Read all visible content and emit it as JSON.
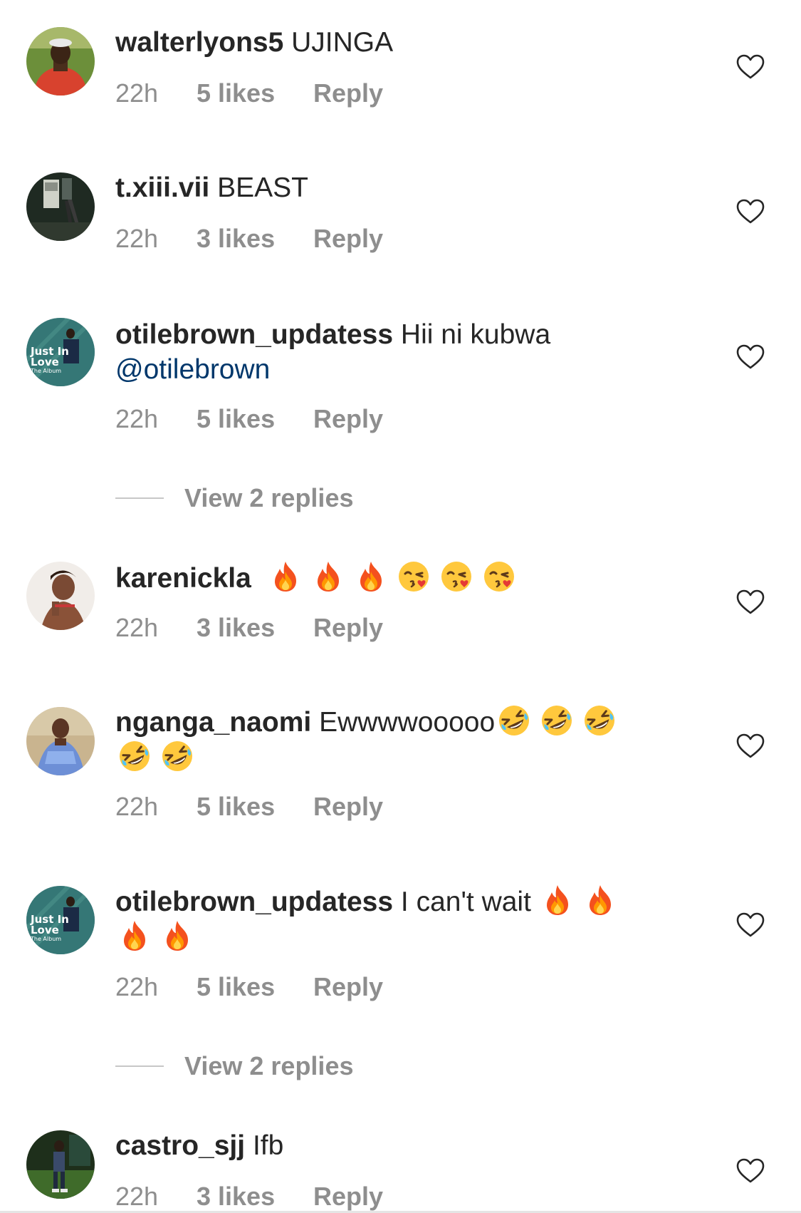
{
  "comments": [
    {
      "username": "walterlyons5",
      "text": "UJINGA",
      "time": "22h",
      "likes": "5 likes",
      "reply": "Reply",
      "avatar": "avatar-photo"
    },
    {
      "username": "t.xiii.vii",
      "text": "BEAST",
      "time": "22h",
      "likes": "3 likes",
      "reply": "Reply",
      "avatar": "avatar-photo"
    },
    {
      "username": "otilebrown_updatess",
      "text": "Hii ni kubwa",
      "mention": "@otilebrown",
      "time": "22h",
      "likes": "5 likes",
      "reply": "Reply",
      "avatar": "avatar-album-cover",
      "view_replies": "View 2 replies"
    },
    {
      "username": "karenickla",
      "text": "",
      "emojis": [
        "fire-emoji",
        "fire-emoji",
        "fire-emoji",
        "kiss-emoji",
        "kiss-emoji",
        "kiss-emoji"
      ],
      "time": "22h",
      "likes": "3 likes",
      "reply": "Reply",
      "avatar": "avatar-photo"
    },
    {
      "username": "nganga_naomi",
      "text": "Ewwwwooooo",
      "emojis": [
        "rofl-emoji",
        "rofl-emoji",
        "rofl-emoji",
        "rofl-emoji",
        "rofl-emoji"
      ],
      "time": "22h",
      "likes": "5 likes",
      "reply": "Reply",
      "avatar": "avatar-photo"
    },
    {
      "username": "otilebrown_updatess",
      "text": "I can't wait",
      "emojis": [
        "fire-emoji",
        "fire-emoji",
        "fire-emoji",
        "fire-emoji"
      ],
      "time": "22h",
      "likes": "5 likes",
      "reply": "Reply",
      "avatar": "avatar-album-cover",
      "view_replies": "View 2 replies"
    },
    {
      "username": "castro_sjj",
      "text": "Ifb",
      "time": "22h",
      "likes": "3 likes",
      "reply": "Reply",
      "avatar": "avatar-photo"
    }
  ],
  "album_cover_text": {
    "line1": "Just In",
    "line2": "Love",
    "line3": "The Album"
  },
  "colors": {
    "username": "#262626",
    "meta": "#8e8e8e",
    "mention": "#00376b",
    "divider": "#c7c7c7"
  }
}
